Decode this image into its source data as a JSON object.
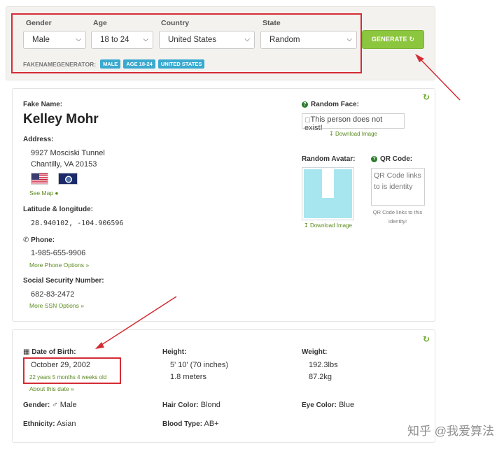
{
  "filters": {
    "gender_label": "Gender",
    "age_label": "Age",
    "country_label": "Country",
    "state_label": "State",
    "gender_value": "Male",
    "age_value": "18 to 24",
    "country_value": "United States",
    "state_value": "Random",
    "generate_label": "GENERATE",
    "brand": "FAKENAMEGENERATOR:",
    "tags": [
      "MALE",
      "AGE 18-24",
      "UNITED STATES"
    ]
  },
  "identity": {
    "fake_name_label": "Fake Name:",
    "name": "Kelley Mohr",
    "address_label": "Address:",
    "address_line1": "9927 Mosciski Tunnel",
    "address_line2": "Chantilly, VA 20153",
    "see_map": "See Map",
    "latlng_label": "Latitude & longitude:",
    "latlng": "28.940102, -104.906596",
    "phone_label": "Phone:",
    "phone": "1-985-655-9906",
    "more_phone": "More Phone Options »",
    "ssn_label": "Social Security Number:",
    "ssn": "682-83-2472",
    "more_ssn": "More SSN Options »"
  },
  "media": {
    "random_face_label": "Random Face:",
    "face_alt": "This person does not exist!",
    "download_image": "Download Image",
    "random_avatar_label": "Random Avatar:",
    "qr_label": "QR Code:",
    "qr_alt": "QR Code links to is identity",
    "qr_caption": "QR Code links to this Identity!"
  },
  "details": {
    "dob_label": "Date of Birth:",
    "dob": "October 29, 2002",
    "age_text": "22 years 5 months 4 weeks old",
    "about_date": "About this date »",
    "height_label": "Height:",
    "height_ft": "5' 10' (70 inches)",
    "height_m": "1.8 meters",
    "weight_label": "Weight:",
    "weight_lbs": "192.3lbs",
    "weight_kg": "87.2kg",
    "gender_label": "Gender:",
    "gender_value": "Male",
    "hair_label": "Hair Color:",
    "hair_value": "Blond",
    "eye_label": "Eye Color:",
    "eye_value": "Blue",
    "ethnicity_label": "Ethnicity:",
    "ethnicity_value": "Asian",
    "blood_label": "Blood Type:",
    "blood_value": "AB+"
  },
  "watermark": "知乎 @我爱算法",
  "colors": {
    "accent_green": "#8cc63e",
    "tag_blue": "#3aa9cf",
    "annotation_red": "#d42c35",
    "link_green": "#5b8a1f"
  }
}
